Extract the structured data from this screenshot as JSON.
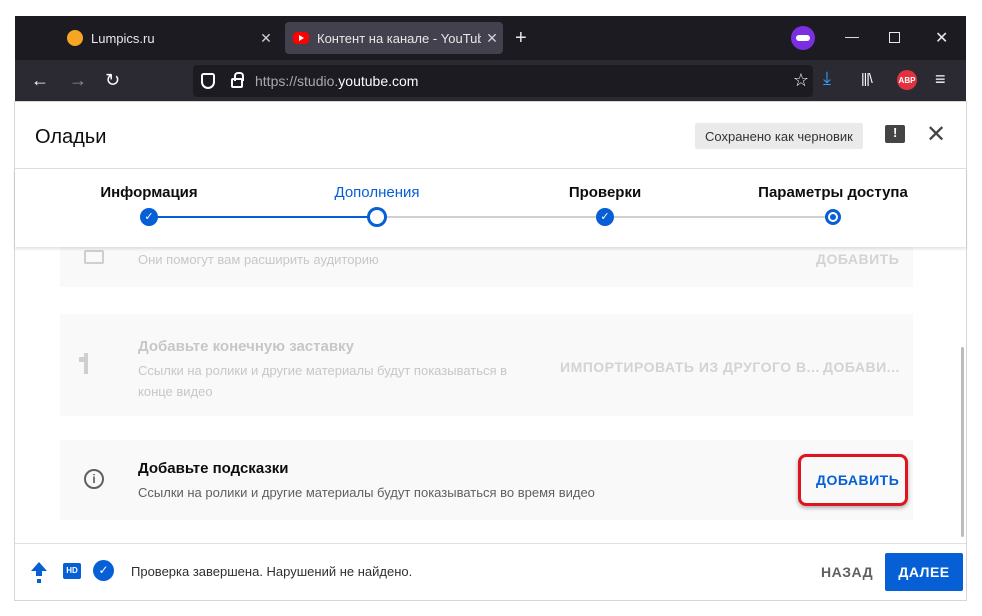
{
  "browser": {
    "tabs": [
      {
        "title": "Lumpics.ru"
      },
      {
        "title": "Контент на канале - YouTube S"
      }
    ],
    "url_prefix": "https://studio.",
    "url_host": "youtube.com",
    "abp_label": "ABP"
  },
  "modal": {
    "title": "Оладьи",
    "draft_badge": "Сохранено как черновик",
    "steps": [
      {
        "label": "Информация",
        "state": "done"
      },
      {
        "label": "Дополнения",
        "state": "current"
      },
      {
        "label": "Проверки",
        "state": "done"
      },
      {
        "label": "Параметры доступа",
        "state": "pending"
      }
    ],
    "cards": [
      {
        "description": "Они помогут вам расширить аудиторию",
        "action": "ДОБАВИТЬ",
        "icon": "keyboard-icon"
      },
      {
        "title": "Добавьте конечную заставку",
        "description": "Ссылки на ролики и другие материалы будут показываться в конце видео",
        "import_action": "ИМПОРТИРОВАТЬ ИЗ ДРУГОГО В...",
        "action": "ДОБАВИ...",
        "icon": "endscreen-icon"
      },
      {
        "title": "Добавьте подсказки",
        "description": "Ссылки на ролики и другие материалы будут показываться во время видео",
        "action": "ДОБАВИТЬ",
        "icon": "info-icon"
      }
    ],
    "footer": {
      "hd_badge": "HD",
      "status": "Проверка завершена. Нарушений не найдено.",
      "back": "НАЗАД",
      "next": "ДАЛЕЕ"
    }
  },
  "colors": {
    "accent": "#065fd4",
    "highlight": "#e0141e"
  }
}
